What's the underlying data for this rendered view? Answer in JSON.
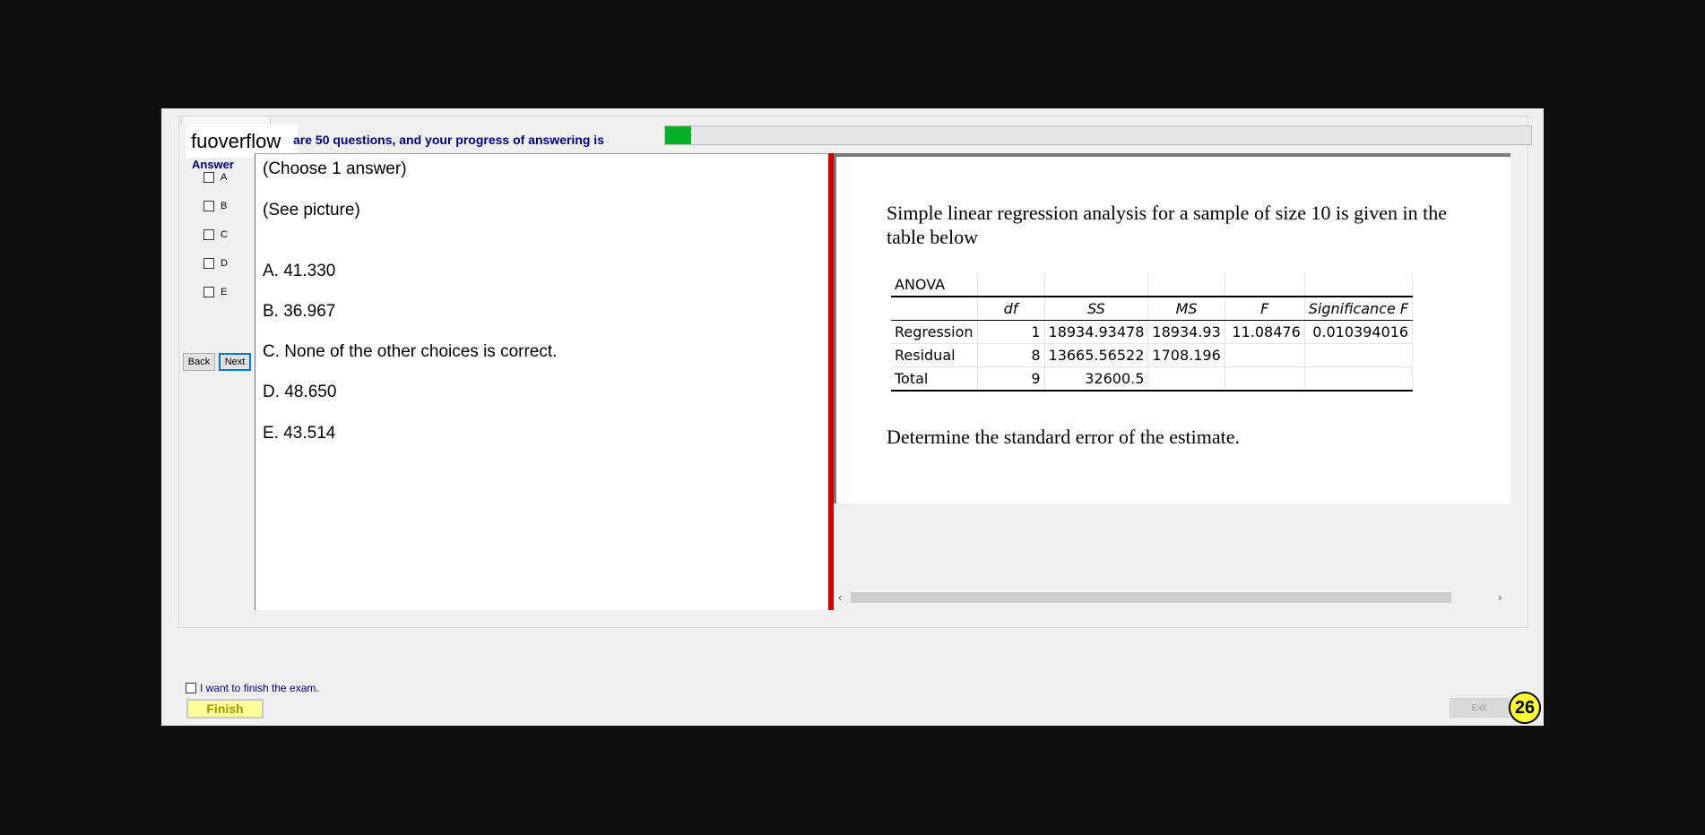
{
  "brand": "fuoverflow",
  "progress": {
    "text": "are 50 questions, and your progress of answering is",
    "fraction": 0.03,
    "color": "#06b025"
  },
  "answer_panel": {
    "heading": "Answer",
    "options": [
      "A",
      "B",
      "C",
      "D",
      "E"
    ],
    "back_label": "Back",
    "next_label": "Next"
  },
  "question": {
    "instruction": "(Choose 1 answer)",
    "prompt": "(See picture)",
    "choices": [
      "A.  41.330",
      "B.  36.967",
      "C.  None of the other choices is correct.",
      "D.  48.650",
      "E.  43.514"
    ]
  },
  "picture": {
    "intro_line1": "Simple linear regression analysis for a sample of size 10 is given in the",
    "intro_line2": "table below",
    "table": {
      "title": "ANOVA",
      "headers": [
        "",
        "df",
        "SS",
        "MS",
        "F",
        "Significance F"
      ],
      "rows": [
        [
          "Regression",
          "1",
          "18934.93478",
          "18934.93",
          "11.08476",
          "0.010394016"
        ],
        [
          "Residual",
          "8",
          "13665.56522",
          "1708.196",
          "",
          ""
        ],
        [
          "Total",
          "9",
          "32600.5",
          "",
          "",
          ""
        ]
      ]
    },
    "question_text": "Determine the standard error of the estimate.",
    "scroll_left": "‹",
    "scroll_right": "›"
  },
  "footer": {
    "finish_checkbox_label": "I want to finish the exam.",
    "finish_label": "Finish",
    "exit_label": "Exit",
    "badge": "26"
  },
  "colors": {
    "splitter": "#d40000",
    "badge": "#ffff33",
    "finish_button": "#ffff99"
  }
}
